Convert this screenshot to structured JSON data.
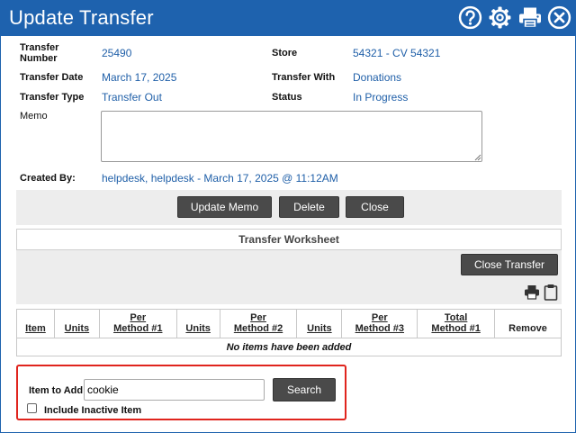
{
  "window": {
    "title": "Update Transfer"
  },
  "header_icons": [
    "help-icon",
    "gear-icon",
    "print-icon",
    "close-icon"
  ],
  "fields": {
    "transfer_number_label": "Transfer\nNumber",
    "transfer_number_value": "25490",
    "store_label": "Store",
    "store_value": "54321 - CV 54321",
    "transfer_date_label": "Transfer Date",
    "transfer_date_value": "March 17, 2025",
    "transfer_with_label": "Transfer With",
    "transfer_with_value": "Donations",
    "transfer_type_label": "Transfer Type",
    "transfer_type_value": "Transfer Out",
    "status_label": "Status",
    "status_value": "In Progress",
    "memo_label": "Memo",
    "memo_value": "",
    "created_by_label": "Created By:",
    "created_by_value": "helpdesk, helpdesk - March 17, 2025 @ 11:12AM"
  },
  "actions": {
    "update_memo": "Update Memo",
    "delete": "Delete",
    "close": "Close"
  },
  "worksheet": {
    "title": "Transfer Worksheet",
    "close_transfer": "Close Transfer",
    "tool_icons": [
      "print-icon",
      "clipboard-icon"
    ],
    "columns": [
      "Item",
      "Units",
      "Per\nMethod #1",
      "Units",
      "Per\nMethod #2",
      "Units",
      "Per\nMethod #3",
      "Total\nMethod #1",
      "Remove"
    ],
    "empty_message": "No items have been added"
  },
  "add_item": {
    "label": "Item to Add:",
    "value": "cookie",
    "search": "Search",
    "include_inactive_label": "Include Inactive Item",
    "include_inactive_checked": false
  },
  "colors": {
    "title_bar": "#1e62ae",
    "link_value": "#1f5fa8",
    "button": "#4a4a4a",
    "highlight_border": "#e0241d"
  }
}
